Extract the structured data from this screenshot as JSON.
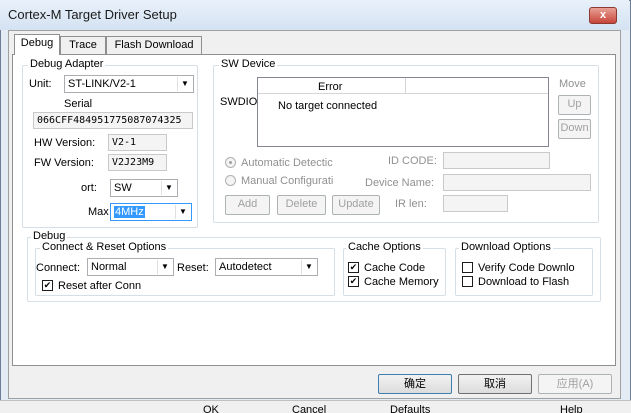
{
  "window": {
    "title": "Cortex-M Target Driver Setup",
    "close_glyph": "x"
  },
  "tabs": [
    "Debug",
    "Trace",
    "Flash Download"
  ],
  "debug_adapter": {
    "legend": "Debug Adapter",
    "unit_label": "Unit:",
    "unit_value": "ST-LINK/V2-1",
    "serial_label": "Serial",
    "serial_value": "066CFF484951775087074325",
    "hw_label": "HW Version:",
    "hw_value": "V2-1",
    "fw_label": "FW Version:",
    "fw_value": "V2J23M9",
    "port_label": "ort:",
    "port_value": "SW",
    "max_label": "Max",
    "max_value": "4MHz"
  },
  "sw_device": {
    "legend": "SW Device",
    "swdio_label": "SWDIO",
    "col_error": "Error",
    "row_text": "No target connected",
    "move_label": "Move",
    "up": "Up",
    "down": "Down",
    "auto_detect": "Automatic Detectic",
    "manual_config": "Manual Configurati",
    "id_code_label": "ID CODE:",
    "device_name_label": "Device Name:",
    "ir_len_label": "IR len:",
    "add": "Add",
    "delete": "Delete",
    "update": "Update"
  },
  "debug": {
    "legend": "Debug",
    "connect_reset_legend": "Connect & Reset Options",
    "connect_label": "Connect:",
    "connect_value": "Normal",
    "reset_label": "Reset:",
    "reset_value": "Autodetect",
    "reset_after_conn": "Reset after Conn",
    "cache_legend": "Cache Options",
    "cache_code": "Cache Code",
    "cache_memory": "Cache Memory",
    "download_legend": "Download Options",
    "verify_code": "Verify Code Downlo",
    "download_flash": "Download to Flash"
  },
  "checkboxes": {
    "reset_after_conn": true,
    "cache_code": true,
    "cache_memory": true,
    "verify_code": false,
    "download_flash": false
  },
  "buttons": {
    "ok": "确定",
    "cancel": "取消",
    "apply": "应用(A)"
  },
  "behind_strip": [
    "OK",
    "Cancel",
    "Defaults",
    "Help"
  ]
}
